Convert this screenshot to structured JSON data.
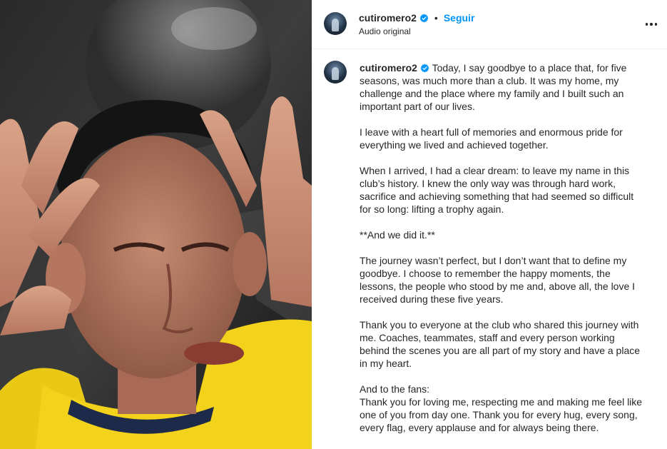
{
  "post": {
    "username": "cutiromero2",
    "follow_label": "Seguir",
    "separator": "•",
    "audio_label": "Audio original"
  },
  "caption": {
    "paragraphs": [
      "Today, I say goodbye to a place that, for five seasons, was much more than a club. It was my home, my challenge and the place where my family and I built such an important part of our lives.",
      "I leave with a heart full of memories and enormous pride for everything we lived and achieved together.",
      "When I arrived, I had a clear dream: to leave my name in this club’s history. I knew the only way was through hard work, sacrifice and achieving something that had seemed so difficult for so long: lifting a trophy again.",
      "**And we did it.**",
      "The journey wasn’t perfect, but I don’t want that to define my goodbye. I choose to remember the happy moments, the lessons, the people who stood by me and, above all, the love I received during these five years.",
      "Thank you to everyone at the club who shared this journey with me. Coaches, teammates, staff and every person working behind the scenes you are all part of my story and have a place in my heart.",
      "And to the fans:",
      "Thank you for loving me, respecting me and making me feel like one of you from day one. Thank you for every hug, every song, every flag, every applause and for always being there."
    ]
  },
  "colors": {
    "accent": "#0095f6",
    "verified": "#0095f6",
    "jersey": "#f2d21a"
  },
  "icons": {
    "verified": "verified-badge-icon",
    "more": "more-options-icon"
  }
}
